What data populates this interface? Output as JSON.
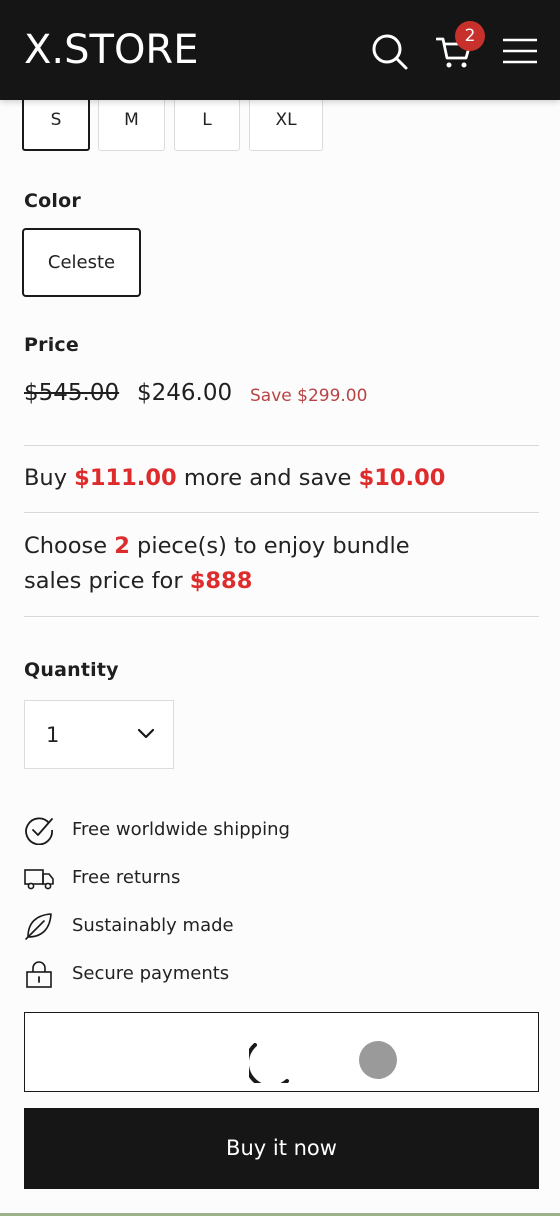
{
  "header": {
    "logo": "X.STORE",
    "cart_count": "2",
    "icons": [
      "search-icon",
      "cart-icon",
      "menu-icon"
    ]
  },
  "size": {
    "options": [
      "S",
      "M",
      "L",
      "XL"
    ],
    "selected": "S"
  },
  "color": {
    "label": "Color",
    "selected": "Celeste"
  },
  "price": {
    "label": "Price",
    "original": "$545.00",
    "current": "$246.00",
    "save": "Save $299.00"
  },
  "promos": {
    "spend": {
      "pre": "Buy",
      "amount": "$111.00",
      "mid": "more and save",
      "discount": "$10.00"
    },
    "bundle": {
      "pre": "Choose",
      "count": "2",
      "mid": "piece(s) to enjoy bundle",
      "line2_pre": "sales price for",
      "price": "$888"
    }
  },
  "quantity": {
    "label": "Quantity",
    "value": "1"
  },
  "features": [
    {
      "icon": "check-circle-icon",
      "label": "Free worldwide shipping"
    },
    {
      "icon": "truck-icon",
      "label": "Free returns"
    },
    {
      "icon": "leaf-icon",
      "label": "Sustainably made"
    },
    {
      "icon": "lock-icon",
      "label": "Secure payments"
    }
  ],
  "buy_now": "Buy it now",
  "colors": {
    "header_bg": "#151515",
    "accent_red": "#de2b2b",
    "save_red": "#b74444",
    "badge_red": "#c8302c"
  }
}
